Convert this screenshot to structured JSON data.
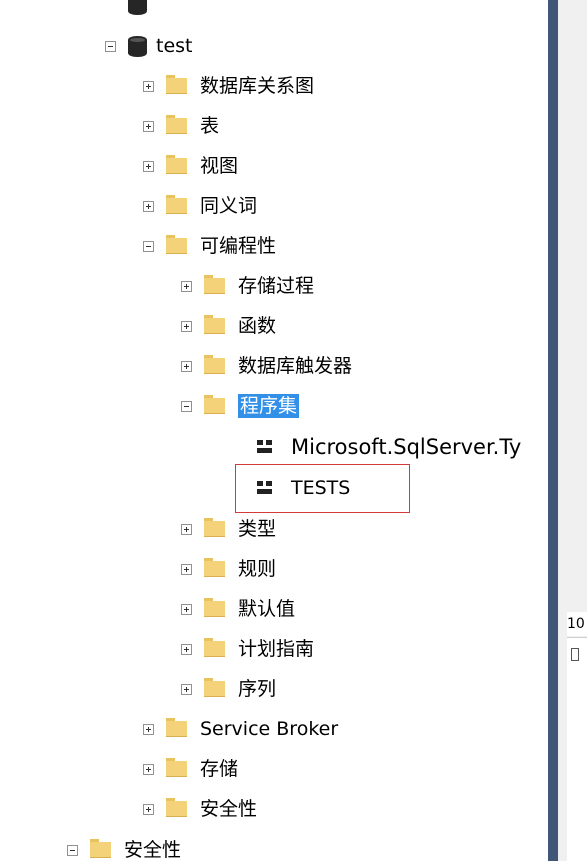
{
  "tree": {
    "nodes": [
      {
        "label": "test",
        "icon": "database-icon",
        "expanded": true
      },
      {
        "label": "数据库关系图",
        "icon": "folder-icon",
        "expanded": false
      },
      {
        "label": "表",
        "icon": "folder-icon",
        "expanded": false
      },
      {
        "label": "视图",
        "icon": "folder-icon",
        "expanded": false
      },
      {
        "label": "同义词",
        "icon": "folder-icon",
        "expanded": false
      },
      {
        "label": "可编程性",
        "icon": "folder-icon",
        "expanded": true
      },
      {
        "label": "存储过程",
        "icon": "folder-icon",
        "expanded": false
      },
      {
        "label": "函数",
        "icon": "folder-icon",
        "expanded": false
      },
      {
        "label": "数据库触发器",
        "icon": "folder-icon",
        "expanded": false
      },
      {
        "label": "程序集",
        "icon": "folder-icon",
        "expanded": true,
        "selected": true
      },
      {
        "label": "Microsoft.SqlServer.Ty",
        "icon": "assembly-icon"
      },
      {
        "label": "TESTS",
        "icon": "assembly-icon",
        "highlighted": true
      },
      {
        "label": "类型",
        "icon": "folder-icon",
        "expanded": false
      },
      {
        "label": "规则",
        "icon": "folder-icon",
        "expanded": false
      },
      {
        "label": "默认值",
        "icon": "folder-icon",
        "expanded": false
      },
      {
        "label": "计划指南",
        "icon": "folder-icon",
        "expanded": false
      },
      {
        "label": "序列",
        "icon": "folder-icon",
        "expanded": false
      },
      {
        "label": "Service Broker",
        "icon": "folder-icon",
        "expanded": false
      },
      {
        "label": "存储",
        "icon": "folder-icon",
        "expanded": false
      },
      {
        "label": "安全性",
        "icon": "folder-icon",
        "expanded": false
      },
      {
        "label": "安全性",
        "icon": "folder-icon",
        "expanded": true
      }
    ]
  },
  "right_pane": {
    "status_text": "10"
  },
  "colors": {
    "selection": "#3390e8",
    "highlight_border": "#d33a3a",
    "folder": "#f3d27a",
    "pane_strip": "#425677"
  }
}
